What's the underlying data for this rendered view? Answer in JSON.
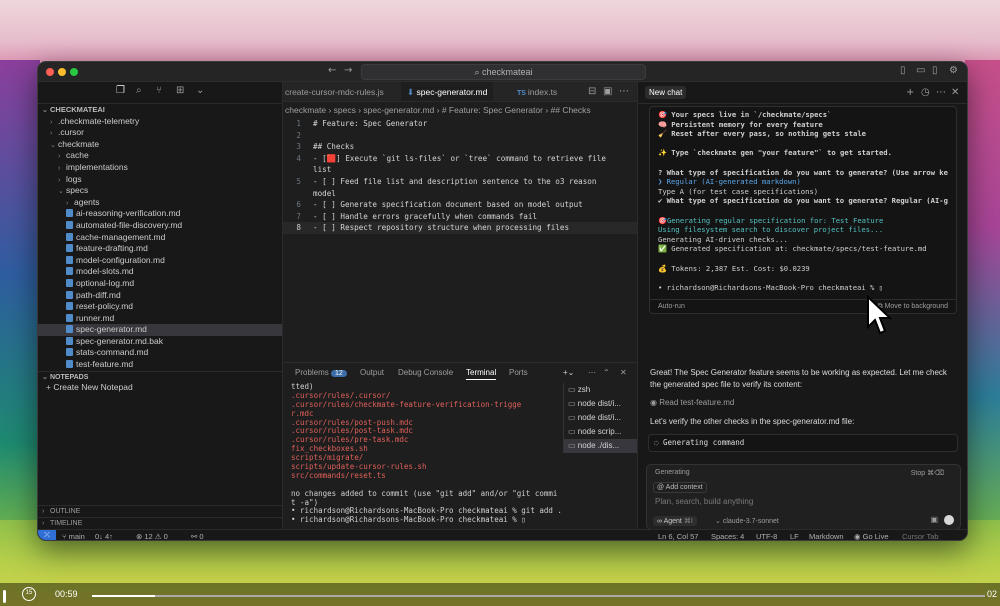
{
  "window": {
    "search": "checkmateai"
  },
  "sidebar": {
    "root": "CHECKMATEAI",
    "items": [
      {
        "label": ".checkmate-telemetry",
        "indent": 1,
        "kind": "folder",
        "open": false
      },
      {
        "label": ".cursor",
        "indent": 1,
        "kind": "folder",
        "open": false
      },
      {
        "label": "checkmate",
        "indent": 1,
        "kind": "folder",
        "open": true
      },
      {
        "label": "cache",
        "indent": 2,
        "kind": "folder",
        "open": false
      },
      {
        "label": "implementations",
        "indent": 2,
        "kind": "folder",
        "open": false
      },
      {
        "label": "logs",
        "indent": 2,
        "kind": "folder",
        "open": false
      },
      {
        "label": "specs",
        "indent": 2,
        "kind": "folder",
        "open": true
      },
      {
        "label": "agents",
        "indent": 3,
        "kind": "folder",
        "open": false
      },
      {
        "label": "ai-reasoning-verification.md",
        "indent": 3,
        "kind": "md"
      },
      {
        "label": "automated-file-discovery.md",
        "indent": 3,
        "kind": "md"
      },
      {
        "label": "cache-management.md",
        "indent": 3,
        "kind": "md"
      },
      {
        "label": "feature-drafting.md",
        "indent": 3,
        "kind": "md"
      },
      {
        "label": "model-configuration.md",
        "indent": 3,
        "kind": "md"
      },
      {
        "label": "model-slots.md",
        "indent": 3,
        "kind": "md"
      },
      {
        "label": "optional-log.md",
        "indent": 3,
        "kind": "md"
      },
      {
        "label": "path-diff.md",
        "indent": 3,
        "kind": "md"
      },
      {
        "label": "reset-policy.md",
        "indent": 3,
        "kind": "md"
      },
      {
        "label": "runner.md",
        "indent": 3,
        "kind": "md"
      },
      {
        "label": "spec-generator.md",
        "indent": 3,
        "kind": "md",
        "selected": true
      },
      {
        "label": "spec-generator.md.bak",
        "indent": 3,
        "kind": "md"
      },
      {
        "label": "stats-command.md",
        "indent": 3,
        "kind": "md"
      },
      {
        "label": "test-feature.md",
        "indent": 3,
        "kind": "md"
      }
    ],
    "notepads": "NOTEPADS",
    "new_notepad": "Create New Notepad",
    "outline": "OUTLINE",
    "timeline": "TIMELINE"
  },
  "editor": {
    "tabs": [
      "create-cursor-mdc-rules.js",
      "spec-generator.md",
      "index.ts"
    ],
    "active_tab": 1,
    "breadcrumb": "checkmate › specs › spec-generator.md › # Feature: Spec Generator › ## Checks",
    "lines": [
      {
        "n": "1",
        "text": "# Feature: Spec Generator"
      },
      {
        "n": "2",
        "text": ""
      },
      {
        "n": "3",
        "text": "## Checks"
      },
      {
        "n": "4",
        "text": "- [🟥] Execute `git ls-files` or `tree` command to retrieve file"
      },
      {
        "n": "",
        "text": "list"
      },
      {
        "n": "5",
        "text": "- [ ] Feed file list and description sentence to the o3 reason"
      },
      {
        "n": "",
        "text": "model"
      },
      {
        "n": "6",
        "text": "- [ ] Generate specification document based on model output"
      },
      {
        "n": "7",
        "text": "- [ ] Handle errors gracefully when commands fail"
      },
      {
        "n": "8",
        "text": "- [ ] Respect repository structure when processing files",
        "current": true
      }
    ]
  },
  "panel": {
    "tabs": [
      "Problems",
      "Output",
      "Debug Console",
      "Terminal",
      "Ports"
    ],
    "problems_count": "12",
    "active_tab": "Terminal",
    "terminal_lines": [
      {
        "text": "tted)",
        "color": "normal"
      },
      {
        "text": "        .cursor/rules/.cursor/",
        "color": "red"
      },
      {
        "text": "        .cursor/rules/checkmate-feature-verification-trigge",
        "color": "red"
      },
      {
        "text": "r.mdc",
        "color": "red"
      },
      {
        "text": "        .cursor/rules/post-push.mdc",
        "color": "red"
      },
      {
        "text": "        .cursor/rules/post-task.mdc",
        "color": "red"
      },
      {
        "text": "        .cursor/rules/pre-task.mdc",
        "color": "red"
      },
      {
        "text": "        fix_checkboxes.sh",
        "color": "red"
      },
      {
        "text": "        scripts/migrate/",
        "color": "red"
      },
      {
        "text": "        scripts/update-cursor-rules.sh",
        "color": "red"
      },
      {
        "text": "        src/commands/reset.ts",
        "color": "red"
      },
      {
        "text": "",
        "color": "normal"
      },
      {
        "text": "no changes added to commit (use \"git add\" and/or \"git commi",
        "color": "normal"
      },
      {
        "text": "t -a\")",
        "color": "normal"
      },
      {
        "text": "• richardson@Richardsons-MacBook-Pro checkmateai % git add .",
        "color": "normal"
      },
      {
        "text": "• richardson@Richardsons-MacBook-Pro checkmateai % ▯",
        "color": "normal"
      }
    ],
    "terminals": [
      "zsh",
      "node dist/i...",
      "node dist/i...",
      "node scrip...",
      "node ./dis..."
    ]
  },
  "chat": {
    "title": "New chat",
    "term_lines": [
      {
        "text": "🎯 Your specs live in `/checkmate/specs`",
        "style": "b"
      },
      {
        "text": "🧠 Persistent memory for every feature",
        "style": "b"
      },
      {
        "text": "🧹 Reset after every pass, so nothing gets stale",
        "style": "b"
      },
      {
        "text": "",
        "style": ""
      },
      {
        "text": "✨ Type `checkmate gen \"your feature\"` to get started.",
        "style": "b"
      },
      {
        "text": "",
        "style": ""
      },
      {
        "text": "? What type of specification do you want to generate? (Use arrow ke",
        "style": "b"
      },
      {
        "text": "❯ Regular (AI-generated markdown)",
        "style": "blu"
      },
      {
        "text": "  Type A (for test case specifications)",
        "style": ""
      },
      {
        "text": "✔ What type of specification do you want to generate? Regular (AI-g",
        "style": "b"
      },
      {
        "text": "",
        "style": ""
      },
      {
        "text": "🎯Generating regular specification for: Test Feature",
        "style": "cyn"
      },
      {
        "text": "Using filesystem search to discover project files...",
        "style": "cyn"
      },
      {
        "text": "Generating AI-driven checks...",
        "style": ""
      },
      {
        "text": "✅ Generated specification at: checkmate/specs/test-feature.md",
        "style": ""
      },
      {
        "text": "",
        "style": ""
      },
      {
        "text": "💰 Tokens: 2,387  Est. Cost: $0.0239",
        "style": ""
      },
      {
        "text": "",
        "style": ""
      },
      {
        "text": "• richardson@Richardsons-MacBook-Pro checkmateai % ▯",
        "style": ""
      }
    ],
    "auto_run": "Auto-run",
    "move_bg": "Move to background",
    "message1": "Great! The Spec Generator feature seems to be working as expected. Let me check the generated spec file to verify its content:",
    "read_file": "Read test-feature.md",
    "message2": "Let's verify the other checks in the spec-generator.md file:",
    "generating_cmd": "Generating command",
    "composer": {
      "status": "Generating",
      "stop": "Stop",
      "add_context": "Add context",
      "placeholder": "Plan, search, build anything",
      "agent": "Agent",
      "agent_key": "⌘I",
      "model": "claude-3.7-sonnet"
    }
  },
  "statusbar": {
    "branch": "main",
    "sync": "0↓ 4↑",
    "problems": "⊗ 12 ⚠ 0",
    "ports": "0",
    "position": "Ln 6, Col 57",
    "spaces": "Spaces: 4",
    "encoding": "UTF-8",
    "eol": "LF",
    "lang": "Markdown",
    "golive": "Go Live",
    "cursortab": "Cursor Tab"
  },
  "video": {
    "time_elapsed": "00:59",
    "time_end": "02",
    "progress": 0.07
  }
}
